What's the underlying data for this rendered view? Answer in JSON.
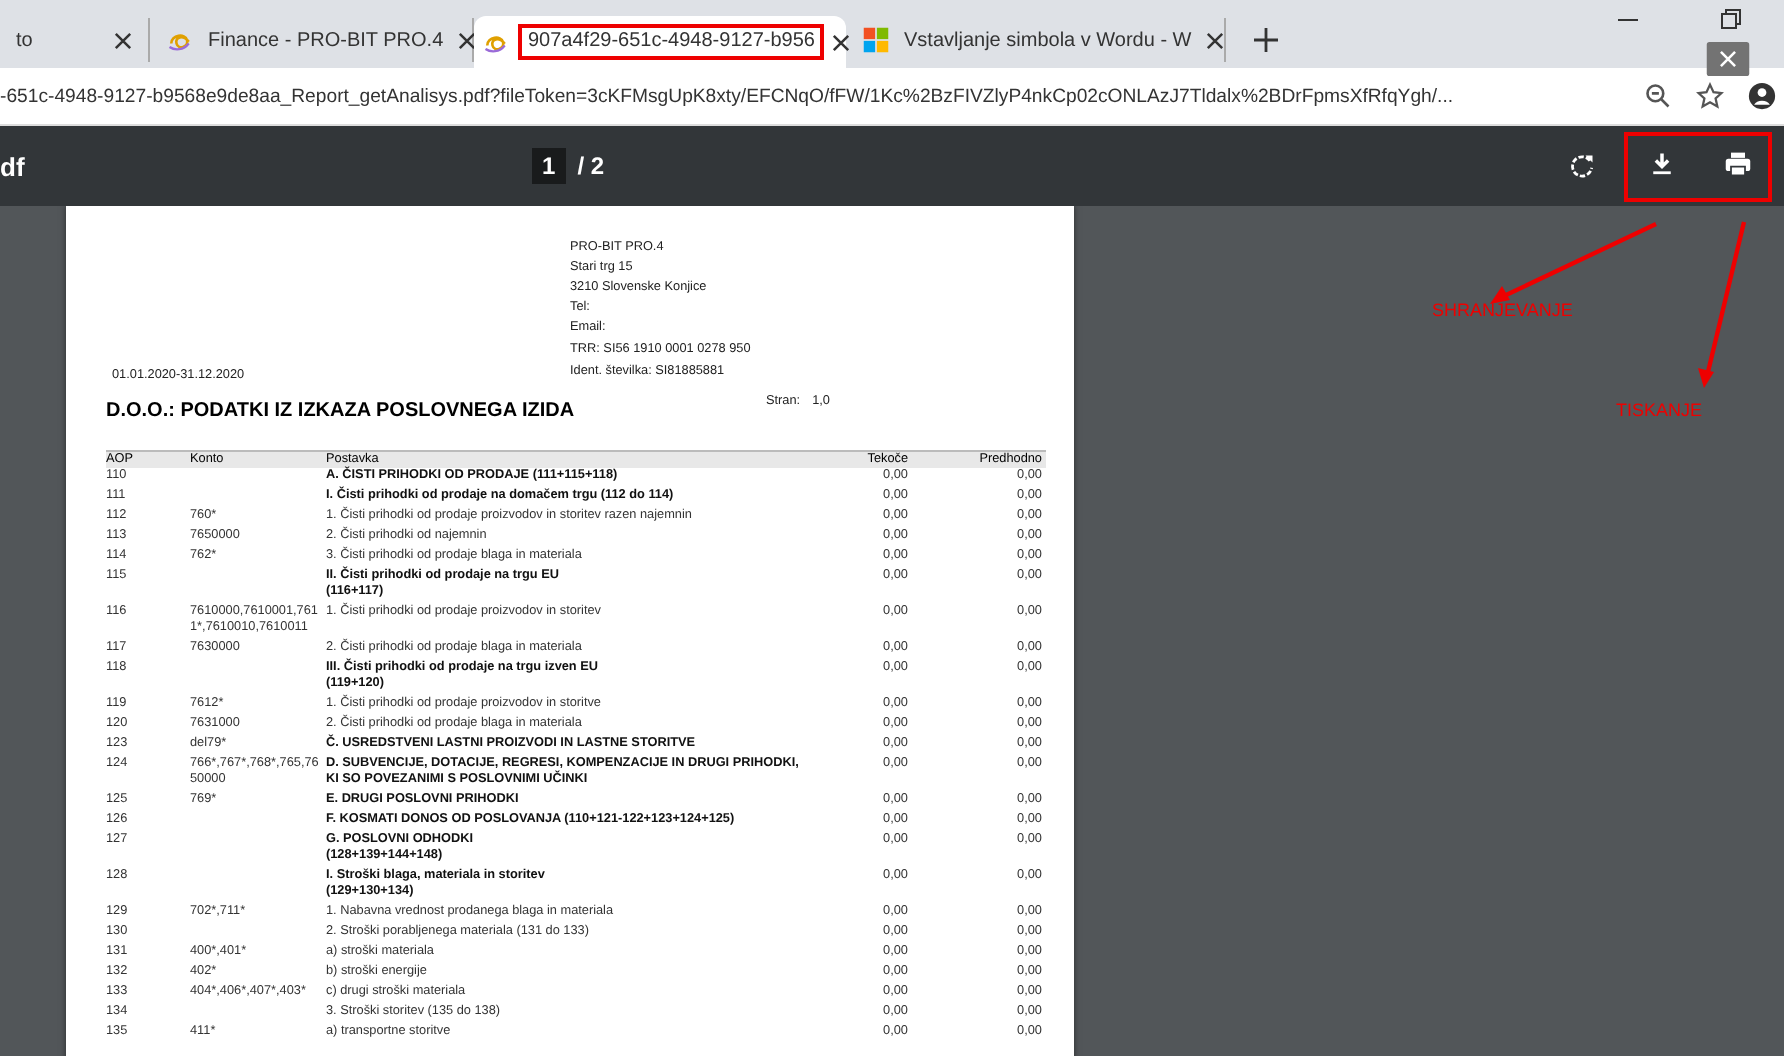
{
  "tabs": [
    {
      "title": "to",
      "selected": false,
      "marked": false
    },
    {
      "title": "Finance - PRO-BIT PRO.4",
      "selected": false,
      "marked": false
    },
    {
      "title": "907a4f29-651c-4948-9127-b956",
      "selected": true,
      "marked": true
    },
    {
      "title": "Vstavljanje simbola v Wordu - W",
      "selected": false,
      "marked": false
    }
  ],
  "address": {
    "url": "-651c-4948-9127-b9568e9de8aa_Report_getAnalisys.pdf?fileToken=3cKFMsgUpK8xty/EFCNqO/fFW/1Kc%2BzFIVZlyP4nkCp02cONLAzJ7Tldalx%2BDrFpmsXfRfqYgh/..."
  },
  "pdf_toolbar": {
    "title": "df",
    "page": "1",
    "total": "/ 2",
    "actions": [
      {
        "kind": "rotate",
        "marked": false
      },
      {
        "kind": "download",
        "marked": true
      },
      {
        "kind": "print",
        "marked": true
      }
    ]
  },
  "document": {
    "company": [
      "PRO-BIT PRO.4",
      "Stari trg 15",
      "3210 Slovenske Konjice",
      "Tel:",
      "Email:"
    ],
    "bank": [
      "TRR: SI56 1910 0001 0278 950",
      "Ident. številka: SI81885881"
    ],
    "period": "01.01.2020-31.12.2020",
    "title": "D.O.O.: PODATKI IZ IZKAZA POSLOVNEGA IZIDA",
    "page_label": "Stran:",
    "page_value": "1,0",
    "columns": [
      "AOP",
      "Konto",
      "Postavka",
      "Tekoče",
      "Predhodno"
    ],
    "rows": [
      {
        "aop": "110",
        "konto": "",
        "item": "A. ČISTI PRIHODKI OD PRODAJE (111+115+118)",
        "current": "0,00",
        "previous": "0,00",
        "bold": true
      },
      {
        "aop": "111",
        "konto": "",
        "item": "I. Čisti prihodki od prodaje na domačem trgu (112 do 114)",
        "current": "0,00",
        "previous": "0,00",
        "bold": true
      },
      {
        "aop": "112",
        "konto": "760*",
        "item": "1. Čisti prihodki od prodaje proizvodov in storitev razen najemnin",
        "current": "0,00",
        "previous": "0,00",
        "bold": false
      },
      {
        "aop": "113",
        "konto": "7650000",
        "item": "2. Čisti prihodki od najemnin",
        "current": "0,00",
        "previous": "0,00",
        "bold": false
      },
      {
        "aop": "114",
        "konto": "762*",
        "item": "3. Čisti prihodki od prodaje blaga in materiala",
        "current": "0,00",
        "previous": "0,00",
        "bold": false
      },
      {
        "aop": "115",
        "konto": "",
        "item": "II. Čisti prihodki od prodaje na trgu EU\n(116+117)",
        "current": "0,00",
        "previous": "0,00",
        "bold": true
      },
      {
        "aop": "116",
        "konto": "7610000,7610001,7611*,7610010,7610011",
        "item": "1. Čisti prihodki od prodaje proizvodov in storitev",
        "current": "0,00",
        "previous": "0,00",
        "bold": false
      },
      {
        "aop": "117",
        "konto": "7630000",
        "item": "2. Čisti prihodki od prodaje blaga in materiala",
        "current": "0,00",
        "previous": "0,00",
        "bold": false
      },
      {
        "aop": "118",
        "konto": "",
        "item": "III. Čisti prihodki od prodaje na trgu izven EU\n(119+120)",
        "current": "0,00",
        "previous": "0,00",
        "bold": true
      },
      {
        "aop": "119",
        "konto": "7612*",
        "item": "1. Čisti prihodki od prodaje proizvodov in storitve",
        "current": "0,00",
        "previous": "0,00",
        "bold": false
      },
      {
        "aop": "120",
        "konto": "7631000",
        "item": "2. Čisti prihodki od prodaje blaga in materiala",
        "current": "0,00",
        "previous": "0,00",
        "bold": false
      },
      {
        "aop": "123",
        "konto": "del79*",
        "item": "Č. USREDSTVENI LASTNI PROIZVODI IN LASTNE STORITVE",
        "current": "0,00",
        "previous": "0,00",
        "bold": true
      },
      {
        "aop": "124",
        "konto": "766*,767*,768*,765,7650000",
        "item": "D. SUBVENCIJE, DOTACIJE, REGRESI, KOMPENZACIJE IN DRUGI PRIHODKI, KI SO POVEZANIMI S POSLOVNIMI UČINKI",
        "current": "0,00",
        "previous": "0,00",
        "bold": true
      },
      {
        "aop": "125",
        "konto": "769*",
        "item": "E. DRUGI POSLOVNI PRIHODKI",
        "current": "0,00",
        "previous": "0,00",
        "bold": true
      },
      {
        "aop": "126",
        "konto": "",
        "item": "F. KOSMATI DONOS OD POSLOVANJA (110+121-122+123+124+125)",
        "current": "0,00",
        "previous": "0,00",
        "bold": true
      },
      {
        "aop": "127",
        "konto": "",
        "item": "G. POSLOVNI ODHODKI\n(128+139+144+148)",
        "current": "0,00",
        "previous": "0,00",
        "bold": true
      },
      {
        "aop": "128",
        "konto": "",
        "item": "I. Stroški blaga, materiala in storitev\n(129+130+134)",
        "current": "0,00",
        "previous": "0,00",
        "bold": true
      },
      {
        "aop": "129",
        "konto": "702*,711*",
        "item": "1. Nabavna vrednost prodanega blaga in materiala",
        "current": "0,00",
        "previous": "0,00",
        "bold": false
      },
      {
        "aop": "130",
        "konto": "",
        "item": "2. Stroški porabljenega materiala (131 do 133)",
        "current": "0,00",
        "previous": "0,00",
        "bold": false
      },
      {
        "aop": "131",
        "konto": "400*,401*",
        "item": "a) stroški materiala",
        "current": "0,00",
        "previous": "0,00",
        "bold": false
      },
      {
        "aop": "132",
        "konto": "402*",
        "item": "b) stroški energije",
        "current": "0,00",
        "previous": "0,00",
        "bold": false
      },
      {
        "aop": "133",
        "konto": "404*,406*,407*,403*",
        "item": "c) drugi stroški materiala",
        "current": "0,00",
        "previous": "0,00",
        "bold": false
      },
      {
        "aop": "134",
        "konto": "",
        "item": "3. Stroški storitev (135 do 138)",
        "current": "0,00",
        "previous": "0,00",
        "bold": false
      },
      {
        "aop": "135",
        "konto": "411*",
        "item": "a) transportne storitve",
        "current": "0,00",
        "previous": "0,00",
        "bold": false
      }
    ]
  },
  "annotations": [
    {
      "text": "SHRANJEVANJE"
    },
    {
      "text": "TISKANJE"
    }
  ]
}
